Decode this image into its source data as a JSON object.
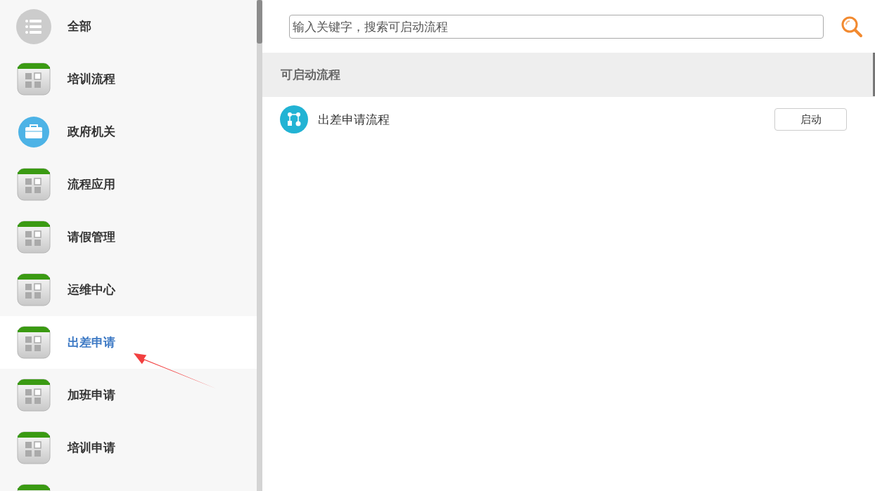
{
  "sidebar": {
    "items": [
      {
        "kind": "all",
        "label": "全部",
        "selected": false
      },
      {
        "kind": "app",
        "label": "培训流程",
        "selected": false
      },
      {
        "kind": "gov",
        "label": "政府机关",
        "selected": false
      },
      {
        "kind": "app",
        "label": "流程应用",
        "selected": false
      },
      {
        "kind": "app",
        "label": "请假管理",
        "selected": false
      },
      {
        "kind": "app",
        "label": "运维中心",
        "selected": false
      },
      {
        "kind": "app",
        "label": "出差申请",
        "selected": true
      },
      {
        "kind": "app",
        "label": "加班申请",
        "selected": false
      },
      {
        "kind": "app",
        "label": "培训申请",
        "selected": false
      },
      {
        "kind": "app"
      }
    ]
  },
  "search": {
    "placeholder": "输入关键字，搜索可启动流程"
  },
  "section": {
    "title": "可启动流程",
    "processes": [
      {
        "name": "出差申请流程",
        "button": "启动"
      }
    ]
  }
}
